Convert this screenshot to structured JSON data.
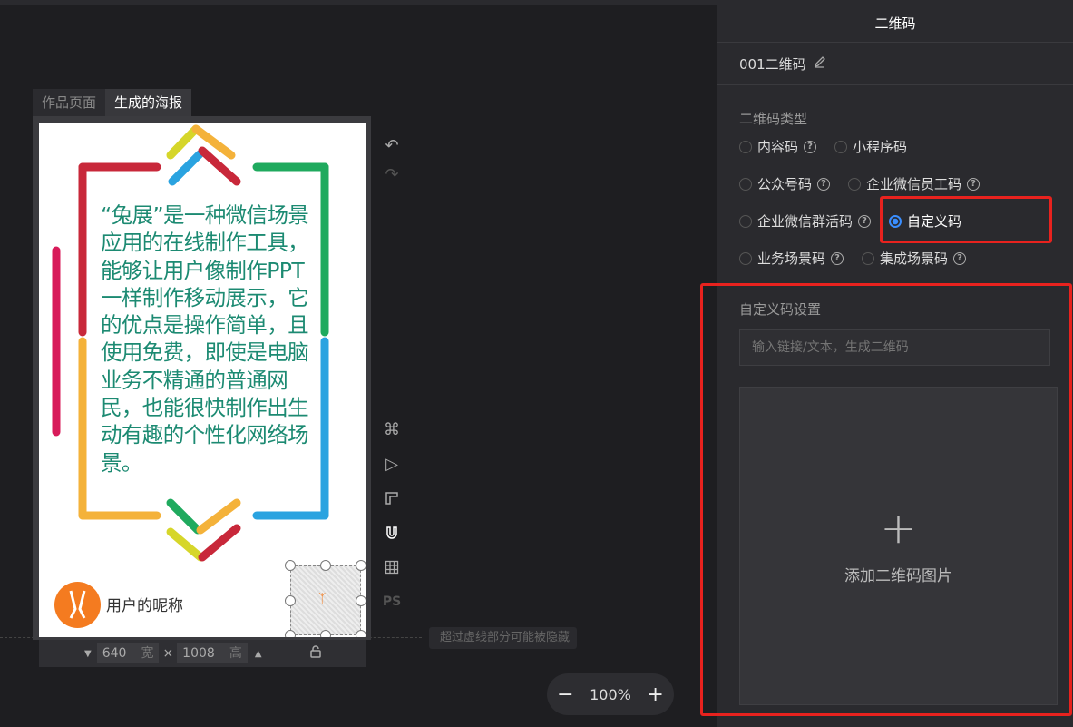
{
  "canvas": {
    "tabs": [
      {
        "label": "作品页面",
        "active": false
      },
      {
        "label": "生成的海报",
        "active": true
      }
    ],
    "poster": {
      "text": "“兔展”是一种微信场景应用的在线制作工具，能够让用户像制作PPT一样制作移动展示，它的优点是操作简单，且使用免费，即使是电脑业务不精通的普通网民，也能很快制作出生动有趣的个性化网络场景。",
      "nickname": "用户的昵称"
    },
    "size": {
      "width": "640",
      "width_unit": "宽",
      "height": "1008",
      "height_unit": "高",
      "sep": "×"
    },
    "hint": "超过虚线部分可能被隐藏",
    "zoom": {
      "level": "100%",
      "minus": "−",
      "plus": "+"
    },
    "tools": [
      "undo-icon",
      "redo-icon",
      "command-icon",
      "play-icon",
      "ruler-icon",
      "magnet-icon",
      "grid-icon",
      "ps-icon"
    ],
    "tool_ps_label": "PS"
  },
  "panel": {
    "title": "二维码",
    "name": "001二维码",
    "type_label": "二维码类型",
    "types": [
      {
        "label": "内容码",
        "help": true,
        "selected": false
      },
      {
        "label": "小程序码",
        "help": false,
        "selected": false
      },
      {
        "label": "公众号码",
        "help": true,
        "selected": false
      },
      {
        "label": "企业微信员工码",
        "help": true,
        "selected": false
      },
      {
        "label": "企业微信群活码",
        "help": true,
        "selected": false
      },
      {
        "label": "自定义码",
        "help": false,
        "selected": true
      },
      {
        "label": "业务场景码",
        "help": true,
        "selected": false
      },
      {
        "label": "集成场景码",
        "help": true,
        "selected": false
      }
    ],
    "help_glyph": "?",
    "custom_label": "自定义码设置",
    "custom_input_placeholder": "输入链接/文本，生成二维码",
    "upload_label": "添加二维码图片",
    "upload_plus": "+"
  },
  "colors": {
    "accent": "#3a8eff",
    "highlight": "#e8221e",
    "poster_text": "#1c8a72",
    "avatar": "#f47b20"
  }
}
